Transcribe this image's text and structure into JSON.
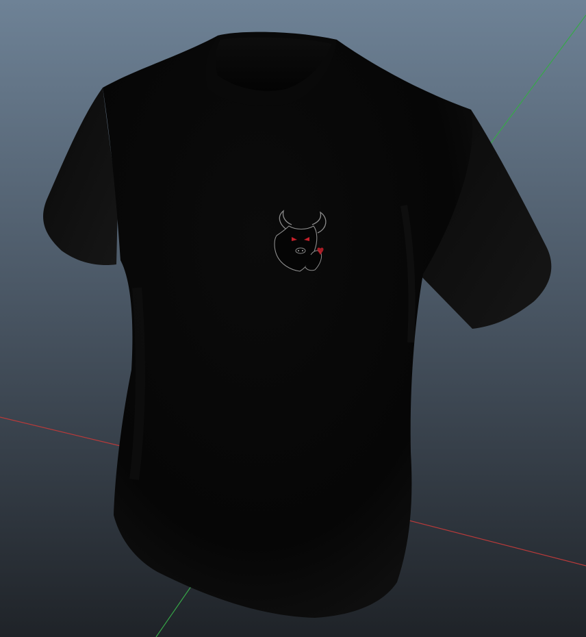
{
  "scene": {
    "object": "t-shirt",
    "colors": {
      "background_top": "#6e8296",
      "background_bottom": "#1f2328",
      "shirt": "#070707",
      "x_axis": "#b83a3a",
      "y_axis": "#37a848",
      "emblem_outline": "#8c8c8c",
      "emblem_eyes": "#c4202a"
    },
    "axes": [
      {
        "name": "x-axis",
        "color": "#b83a3a"
      },
      {
        "name": "y-axis",
        "color": "#37a848"
      }
    ],
    "decal": {
      "icon": "bull-head-emblem-icon"
    }
  }
}
